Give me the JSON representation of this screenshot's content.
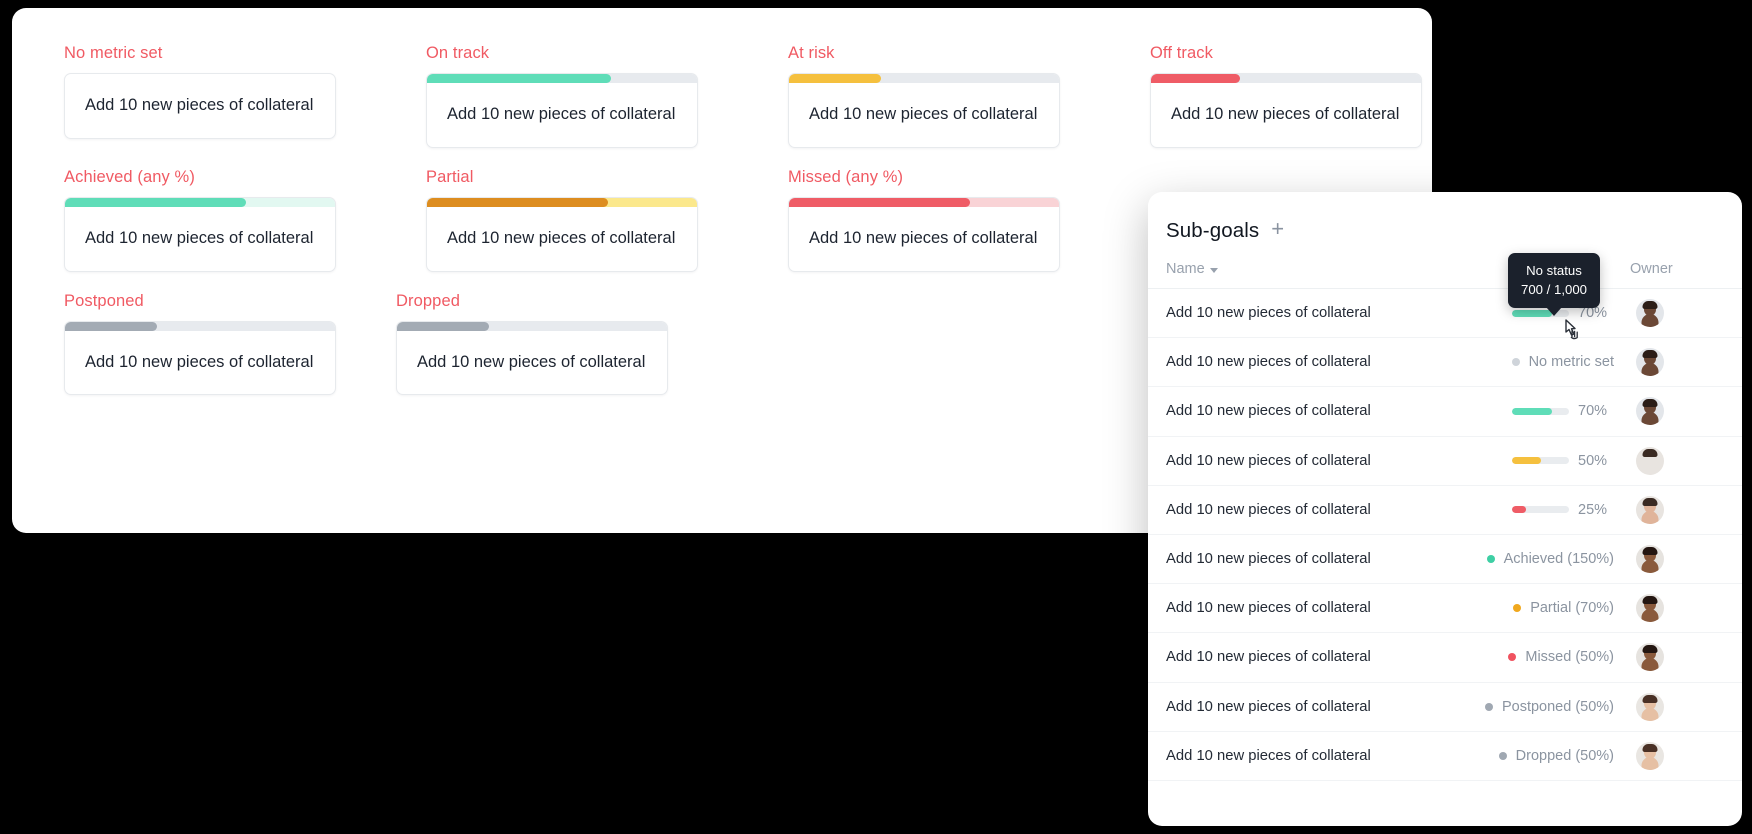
{
  "main_panel": {
    "cards": [
      {
        "label": "No metric set",
        "text": "Add 10 new pieces of collateral",
        "bar": false,
        "pct": 0,
        "fill": "#9aa3ad",
        "track": "#e7eaee"
      },
      {
        "label": "On track",
        "text": "Add 10 new pieces of collateral",
        "bar": true,
        "pct": 68,
        "fill": "#5fddb8",
        "track": "#e7eaee"
      },
      {
        "label": "At risk",
        "text": "Add 10 new pieces of collateral",
        "bar": true,
        "pct": 34,
        "fill": "#f5c03e",
        "track": "#e7eaee"
      },
      {
        "label": "Off track",
        "text": "Add 10 new pieces of collateral",
        "bar": true,
        "pct": 33,
        "fill": "#ef5c66",
        "track": "#e7eaee"
      },
      {
        "label": "Achieved (any %)",
        "text": "Add 10 new pieces of collateral",
        "bar": true,
        "pct": 67,
        "fill": "#5fddb8",
        "track": "#e2f8f1"
      },
      {
        "label": "Partial",
        "text": "Add 10 new pieces of collateral",
        "bar": true,
        "pct": 67,
        "fill": "#dd8d20",
        "track": "#fbe88c"
      },
      {
        "label": "Missed (any %)",
        "text": "Add 10 new pieces of collateral",
        "bar": true,
        "pct": 67,
        "fill": "#ef5c66",
        "track": "#f9d3d6"
      },
      {
        "label": "Postponed",
        "text": "Add 10 new pieces of collateral",
        "bar": true,
        "pct": 34,
        "fill": "#a3abb4",
        "track": "#e7eaee"
      },
      {
        "label": "Dropped",
        "text": "Add 10 new pieces of collateral",
        "bar": true,
        "pct": 34,
        "fill": "#a3abb4",
        "track": "#e7eaee"
      }
    ]
  },
  "subgoals": {
    "title": "Sub-goals",
    "add_label": "+",
    "columns": {
      "name": "Name",
      "owner": "Owner"
    },
    "rows": [
      {
        "name": "Add 10 new pieces of collateral",
        "kind": "bar",
        "pct": 70,
        "pct_label": "70%",
        "fill": "#5fddb8",
        "avatar": {
          "skin": "#6b4836",
          "hair": "#2b1d17",
          "bg": "#e3e6ea"
        }
      },
      {
        "name": "Add 10 new pieces of collateral",
        "kind": "status",
        "status_label": "No metric set",
        "dot": "#cfd4da",
        "avatar": {
          "skin": "#6b4836",
          "hair": "#2b1d17",
          "bg": "#e3e6ea"
        }
      },
      {
        "name": "Add 10 new pieces of collateral",
        "kind": "bar",
        "pct": 70,
        "pct_label": "70%",
        "fill": "#5fddb8",
        "avatar": {
          "skin": "#6b4836",
          "hair": "#2b1d17",
          "bg": "#e3e6ea"
        }
      },
      {
        "name": "Add 10 new pieces of collateral",
        "kind": "bar",
        "pct": 50,
        "pct_label": "50%",
        "fill": "#f5c03e",
        "avatar": {
          "skin": "#d8a храм",
          "hair": "#3a2a22",
          "bg": "#e8e4e0"
        }
      },
      {
        "name": "Add 10 new pieces of collateral",
        "kind": "bar",
        "pct": 25,
        "pct_label": "25%",
        "fill": "#ef5c66",
        "avatar": {
          "skin": "#e0b49a",
          "hair": "#3a2a22",
          "bg": "#e8e4e0"
        }
      },
      {
        "name": "Add 10 new pieces of collateral",
        "kind": "status",
        "status_label": "Achieved (150%)",
        "dot": "#3ecfa4",
        "avatar": {
          "skin": "#8a5a3c",
          "hair": "#241611",
          "bg": "#e6e3df"
        }
      },
      {
        "name": "Add 10 new pieces of collateral",
        "kind": "status",
        "status_label": "Partial (70%)",
        "dot": "#f0a81e",
        "avatar": {
          "skin": "#8a5a3c",
          "hair": "#241611",
          "bg": "#e6e3df"
        }
      },
      {
        "name": "Add 10 new pieces of collateral",
        "kind": "status",
        "status_label": "Missed (50%)",
        "dot": "#f0525f",
        "avatar": {
          "skin": "#8a5a3c",
          "hair": "#241611",
          "bg": "#e6e3df"
        }
      },
      {
        "name": "Add 10 new pieces of collateral",
        "kind": "status",
        "status_label": "Postponed (50%)",
        "dot": "#a0a8b2",
        "avatar": {
          "skin": "#e6c0a4",
          "hair": "#4a3126",
          "bg": "#e9e6e2"
        }
      },
      {
        "name": "Add 10 new pieces of collateral",
        "kind": "status",
        "status_label": "Dropped (50%)",
        "dot": "#a0a8b2",
        "avatar": {
          "skin": "#e6c0a4",
          "hair": "#4a3126",
          "bg": "#e9e6e2"
        }
      }
    ]
  },
  "tooltip": {
    "line1": "No status",
    "line2": "700 / 1,000"
  }
}
